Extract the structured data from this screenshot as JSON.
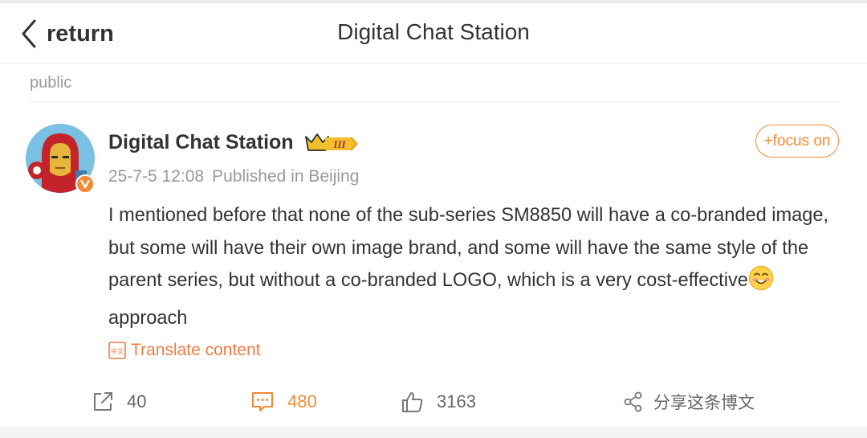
{
  "nav": {
    "back_label": "return",
    "title": "Digital Chat Station"
  },
  "post": {
    "visibility": "public",
    "author": "Digital Chat Station",
    "badge_level": "III",
    "date": "25-7-5 12:08",
    "location": "Published in Beijing",
    "follow_label": "+focus on",
    "text_before_emoji": "I mentioned before that none of the sub-series SM8850 will have a co-branded image, but some will have their own image brand, and some will have the same style of the parent series, but without a co-branded LOGO, which is a very cost-effective",
    "text_after_emoji": "approach",
    "translate_label": "Translate content",
    "translate_icon_text": "中文"
  },
  "actions": {
    "shares": "40",
    "comments": "480",
    "likes": "3163",
    "forward_label": "分享这条博文"
  },
  "colors": {
    "accent": "#f28a35",
    "translate": "#ec7e44",
    "muted": "#999999"
  }
}
